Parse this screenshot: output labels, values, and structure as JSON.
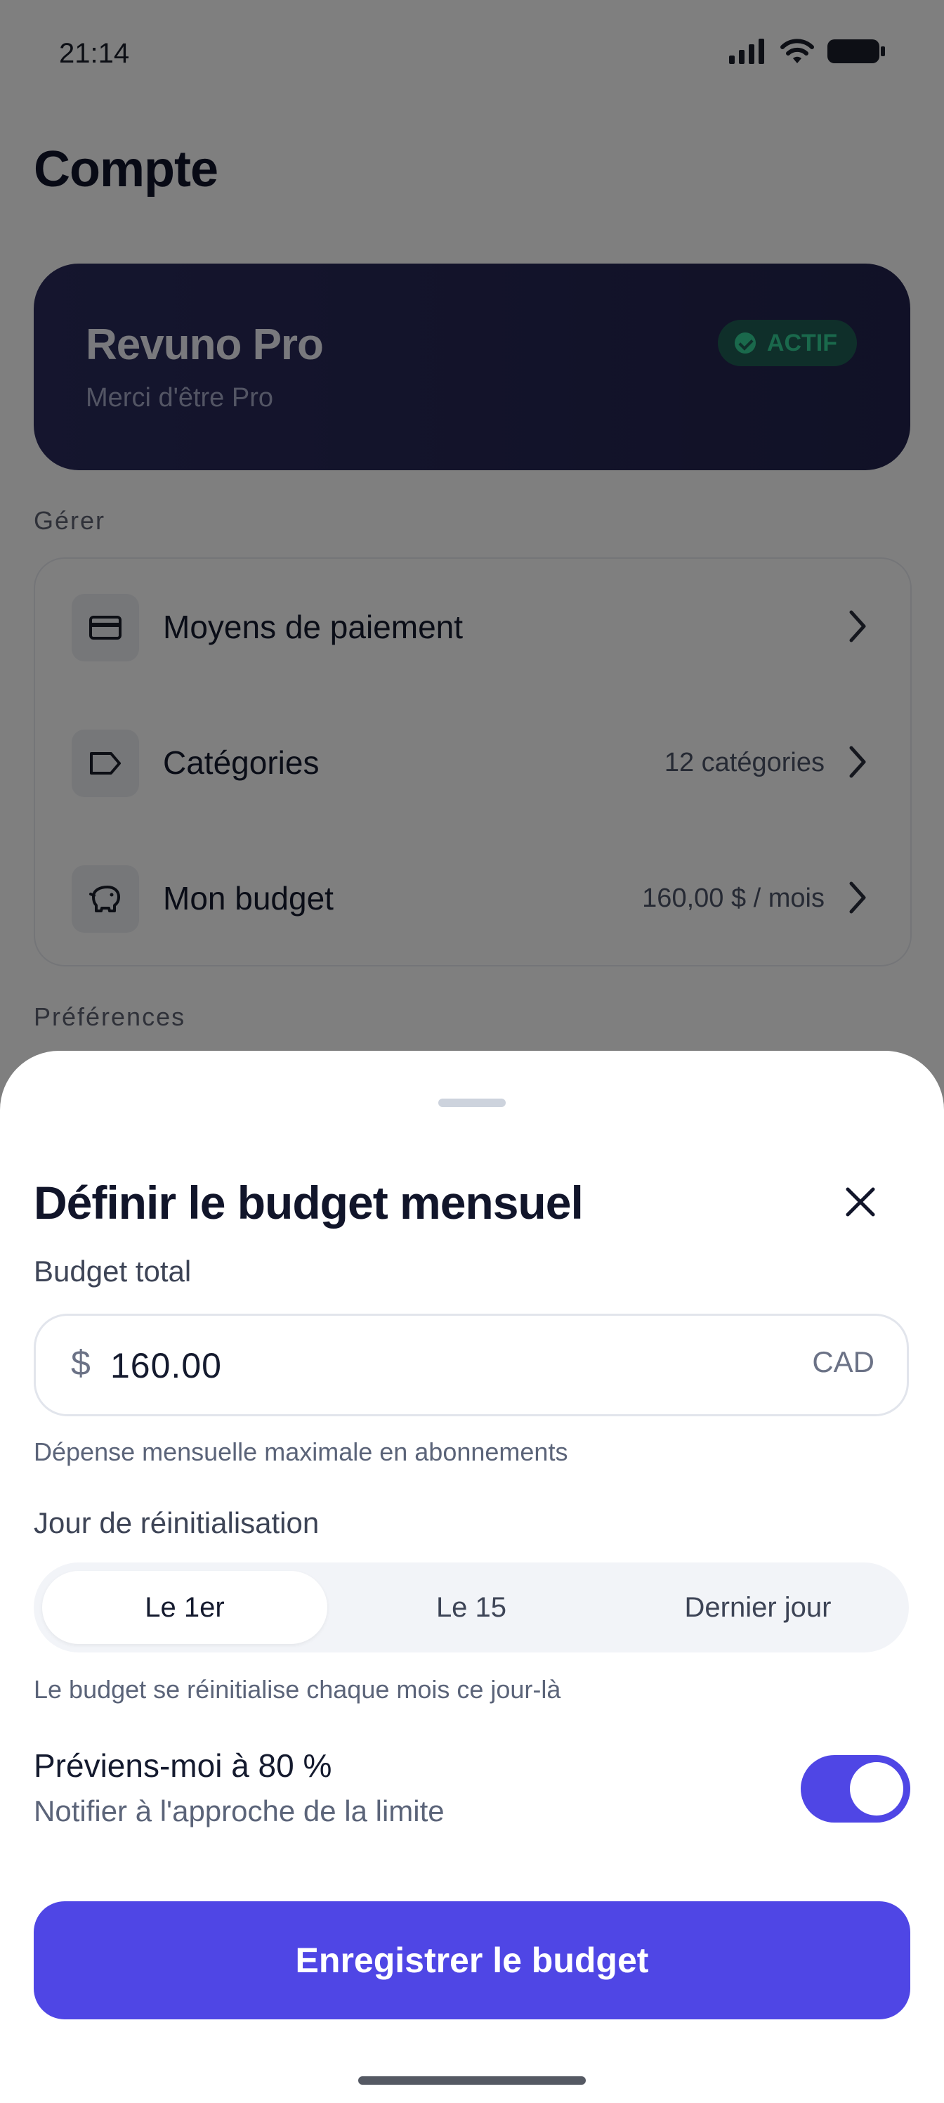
{
  "status_bar": {
    "time": "21:14"
  },
  "page": {
    "title": "Compte"
  },
  "pro_card": {
    "title": "Revuno Pro",
    "subtitle": "Merci d'être Pro",
    "badge": "ACTIF"
  },
  "manage": {
    "section_label": "Gérer",
    "items": [
      {
        "label": "Moyens de paiement",
        "value": "",
        "icon": "credit-card-icon"
      },
      {
        "label": "Catégories",
        "value": "12 catégories",
        "icon": "tag-icon"
      },
      {
        "label": "Mon budget",
        "value": "160,00 $ / mois",
        "icon": "piggy-bank-icon"
      }
    ]
  },
  "preferences": {
    "section_label": "Préférences"
  },
  "sheet": {
    "title": "Définir le budget mensuel",
    "budget_label": "Budget total",
    "currency_symbol": "$",
    "amount": "160.00",
    "currency_code": "CAD",
    "amount_hint": "Dépense mensuelle maximale en abonnements",
    "reset_label": "Jour de réinitialisation",
    "reset_options": [
      "Le 1er",
      "Le 15",
      "Dernier jour"
    ],
    "reset_selected": "Le 1er",
    "reset_hint": "Le budget se réinitialise chaque mois ce jour-là",
    "notify_title": "Préviens-moi à 80 %",
    "notify_subtitle": "Notifier à l'approche de la limite",
    "notify_enabled": true,
    "save_label": "Enregistrer le budget"
  },
  "colors": {
    "accent": "#4f46e5",
    "pro_card": "#22234e",
    "badge_green": "#34d399"
  }
}
